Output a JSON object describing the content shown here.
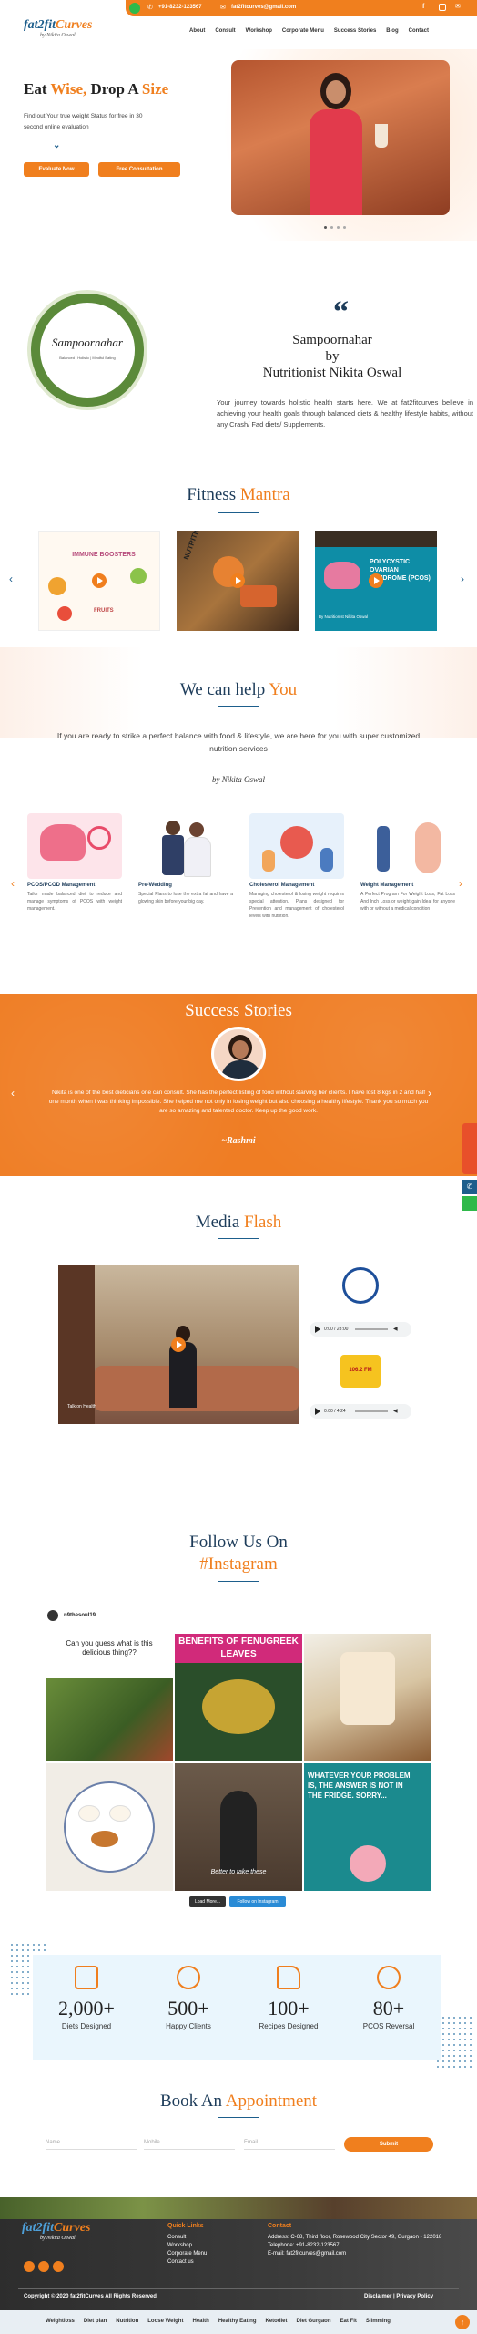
{
  "topbar": {
    "phone": "+91-8232-123567",
    "email": "fat2fitcurves@gmail.com"
  },
  "brand": {
    "logo_main": "fat2fit",
    "logo_accent": "Curves",
    "logo_sub": "by Nikita Oswal"
  },
  "nav": [
    "About",
    "Consult",
    "Workshop",
    "Corporate Menu",
    "Success Stories",
    "Blog",
    "Contact"
  ],
  "hero": {
    "title_1": "Eat ",
    "title_2": "Wise,",
    "title_3": " Drop A ",
    "title_4": "Size",
    "subtitle": "Find out Your true weight Status for free in 30 second online evaluation",
    "btn_evaluate": "Evaluate Now",
    "btn_consult": "Free Consultation"
  },
  "about": {
    "badge": "Sampoornahar",
    "badge_sub": "Balanced | Holistic | Mindful Eating",
    "title_1": "Sampoornahar",
    "title_2": "by",
    "title_3": "Nutritionist Nikita Oswal",
    "text": "Your journey towards holistic health starts here. We at fat2fitcurves believe in achieving your health goals through balanced diets & healthy lifestyle habits, without any Crash/ Fad diets/ Supplements."
  },
  "mantra": {
    "title_1": "Fitness ",
    "title_2": "Mantra",
    "cards": [
      {
        "label": "IMMUNE BOOSTERS",
        "sub": "FRUITS"
      },
      {
        "label": "NUTRITION",
        "sub": ""
      },
      {
        "label": "POLYCYSTIC OVARIAN SYNDROME (PCOS)",
        "sub": "By Nutritionist Nikita Oswal"
      }
    ]
  },
  "help": {
    "title_1": "We can help ",
    "title_2": "You",
    "text": "If you are ready to strike a perfect balance with food & lifestyle, we are here for you with super customized nutrition services",
    "signature": "by Nikita Oswal",
    "cards": [
      {
        "title": "PCOS/PCOD Management",
        "text": "Tailor made balanced diet to reduce and manage symptoms of PCOS with weight management."
      },
      {
        "title": "Pre-Wedding",
        "text": "Special Plans to lose the extra fat and have a glowing skin before your big day."
      },
      {
        "title": "Cholesterol Management",
        "text": "Managing cholesterol & losing weight requires special attention. Plans designed for Prevention and management of cholesterol levels with nutrition."
      },
      {
        "title": "Weight Management",
        "text": "A Perfect Program For Weight Loss, Fat Loss And Inch Loss or weight gain Ideal for anyone with or without a medical condition"
      }
    ]
  },
  "success": {
    "title": "Success Stories",
    "quote": "Nikita is one of the best dieticians one can consult. She has the perfect listing of food without starving her clients. I have lost 8 kgs in 2 and half one month when I was thinking impossible. She helped me not only in losing weight but also choosing a healthy lifestyle. Thank you so much you are so amazing and talented doctor. Keep up the good work.",
    "author": "~Rashmi"
  },
  "media": {
    "title_1": "Media ",
    "title_2": "Flash",
    "video_caption": "Talk on Health",
    "audio_1": "0:00 / 28:00",
    "audio_2": "0:00 / 4:24",
    "radio_label": "106.2 FM"
  },
  "instagram": {
    "title_1": "Follow Us On",
    "title_2": "#Instagram",
    "handle": "n9thesoul19",
    "posts": [
      {
        "text": "Can you guess what is  this delicious thing??"
      },
      {
        "text": "BENEFITS OF FENUGREEK LEAVES"
      },
      {
        "text": ""
      },
      {
        "text": ""
      },
      {
        "text": "Better to take these"
      },
      {
        "text": "WHATEVER YOUR PROBLEM IS, THE ANSWER IS NOT IN THE FRIDGE. SORRY..."
      }
    ],
    "load_more": "Load More...",
    "follow": "Follow on Instagram"
  },
  "stats": [
    {
      "num": "2,000+",
      "label": "Diets Designed",
      "icon": "diet-plan-icon"
    },
    {
      "num": "500+",
      "label": "Happy Clients",
      "icon": "happy-face-icon"
    },
    {
      "num": "100+",
      "label": "Recipes Designed",
      "icon": "recipe-book-icon"
    },
    {
      "num": "80+",
      "label": "PCOS Reversal",
      "icon": "award-badge-icon"
    }
  ],
  "book": {
    "title_1": "Book An ",
    "title_2": "Appointment",
    "name_ph": "Name",
    "mobile_ph": "Mobile",
    "email_ph": "Email",
    "submit": "Submit"
  },
  "footer": {
    "quick_title": "Quick Links",
    "links": [
      "Consult",
      "Workshop",
      "Corporate Menu",
      "Contact us"
    ],
    "contact_title": "Contact",
    "address": "Address: C-68, Third floor, Rosewood City Sector 49, Gurgaon - 122018",
    "telephone": "Telephone: +91-8232-123567",
    "email": "E-mail: fat2fitcurves@gmail.com",
    "copyright": "Copyright © 2020 fat2fitCurves All Rights Reserved",
    "disclaimer": "Disclaimer",
    "privacy": "Privacy Policy"
  },
  "tags": [
    "Weightloss",
    "Diet plan",
    "Nutrition",
    "Loose Weight",
    "Health",
    "Healthy Eating",
    "Ketodiet",
    "Diet Gurgaon",
    "Eat Fit",
    "Slimming"
  ],
  "colors": {
    "accent": "#f07f1e",
    "navy": "#1d3c5a",
    "footer": "#2c2c2c"
  }
}
